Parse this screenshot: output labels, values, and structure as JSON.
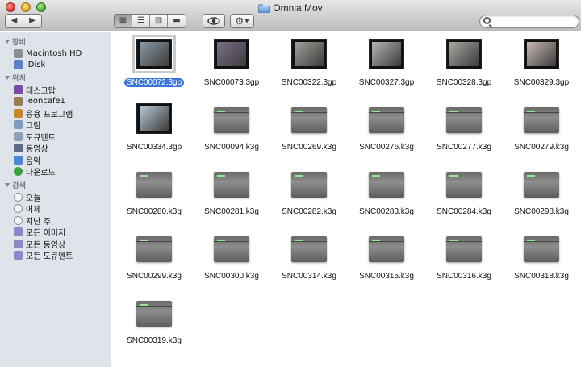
{
  "window": {
    "title": "Omnia Mov"
  },
  "toolbar": {
    "nav": [
      "back-arrow",
      "forward-arrow"
    ],
    "view_modes": [
      "icon-view",
      "list-view",
      "column-view",
      "coverflow-view"
    ],
    "quicklook_icon": "eye",
    "action_icon": "gear",
    "search": {
      "value": "",
      "placeholder": ""
    }
  },
  "sidebar": {
    "sections": [
      {
        "title": "장비",
        "items": [
          {
            "label": "Macintosh HD",
            "icon": "hard-drive",
            "color": "#8a8f96"
          },
          {
            "label": "iDisk",
            "icon": "idisk",
            "color": "#5a83c6"
          }
        ]
      },
      {
        "title": "위치",
        "items": [
          {
            "label": "데스크탑",
            "icon": "desktop",
            "color": "#7b4aa8"
          },
          {
            "label": "leoncafe1",
            "icon": "home",
            "color": "#9a7b55"
          },
          {
            "label": "응용 프로그램",
            "icon": "applications",
            "color": "#c9852b"
          },
          {
            "label": "그림",
            "icon": "pictures",
            "color": "#7d9cc0"
          },
          {
            "label": "도큐멘트",
            "icon": "documents",
            "color": "#8ea0b6"
          },
          {
            "label": "동영상",
            "icon": "movies",
            "color": "#5a6c86"
          },
          {
            "label": "음악",
            "icon": "music",
            "color": "#4a86d3"
          },
          {
            "label": "다운로드",
            "icon": "downloads",
            "color": "#3aa33d"
          }
        ]
      },
      {
        "title": "검색",
        "items": [
          {
            "label": "오늘",
            "icon": "clock",
            "color": "#a6acb4"
          },
          {
            "label": "어제",
            "icon": "clock",
            "color": "#a6acb4"
          },
          {
            "label": "지난 주",
            "icon": "clock",
            "color": "#a6acb4"
          },
          {
            "label": "모든 이미지",
            "icon": "smart-folder",
            "color": "#8c87c9"
          },
          {
            "label": "모든 동영상",
            "icon": "smart-folder",
            "color": "#8c87c9"
          },
          {
            "label": "모든 도큐멘트",
            "icon": "smart-folder",
            "color": "#8c87c9"
          }
        ]
      }
    ]
  },
  "files": [
    {
      "name": "SNC00072.3gp",
      "kind": "photo",
      "selected": true,
      "tint": "#8a9aa6"
    },
    {
      "name": "SNC00073.3gp",
      "kind": "photo",
      "tint": "#7a6f8a"
    },
    {
      "name": "SNC00322.3gp",
      "kind": "photo",
      "tint": "#a3a09a"
    },
    {
      "name": "SNC00327.3gp",
      "kind": "photo",
      "tint": "#b7b3b0"
    },
    {
      "name": "SNC00328.3gp",
      "kind": "photo",
      "tint": "#a9a6a2"
    },
    {
      "name": "SNC00329.3gp",
      "kind": "photo",
      "tint": "#c7b9b6"
    },
    {
      "name": "SNC00334.3gp",
      "kind": "photo",
      "tint": "#b7c7d4"
    },
    {
      "name": "SNC00094.k3g",
      "kind": "k3g"
    },
    {
      "name": "SNC00269.k3g",
      "kind": "k3g"
    },
    {
      "name": "SNC00276.k3g",
      "kind": "k3g"
    },
    {
      "name": "SNC00277.k3g",
      "kind": "k3g"
    },
    {
      "name": "SNC00279.k3g",
      "kind": "k3g"
    },
    {
      "name": "SNC00280.k3g",
      "kind": "k3g"
    },
    {
      "name": "SNC00281.k3g",
      "kind": "k3g"
    },
    {
      "name": "SNC00282.k3g",
      "kind": "k3g"
    },
    {
      "name": "SNC00283.k3g",
      "kind": "k3g"
    },
    {
      "name": "SNC00284.k3g",
      "kind": "k3g"
    },
    {
      "name": "SNC00298.k3g",
      "kind": "k3g"
    },
    {
      "name": "SNC00299.k3g",
      "kind": "k3g"
    },
    {
      "name": "SNC00300.k3g",
      "kind": "k3g"
    },
    {
      "name": "SNC00314.k3g",
      "kind": "k3g"
    },
    {
      "name": "SNC00315.k3g",
      "kind": "k3g"
    },
    {
      "name": "SNC00316.k3g",
      "kind": "k3g"
    },
    {
      "name": "SNC00318.k3g",
      "kind": "k3g"
    },
    {
      "name": "SNC00319.k3g",
      "kind": "k3g"
    }
  ],
  "colors": {
    "selection": "#3875d7",
    "sidebar_bg": "#dfe4ea"
  }
}
